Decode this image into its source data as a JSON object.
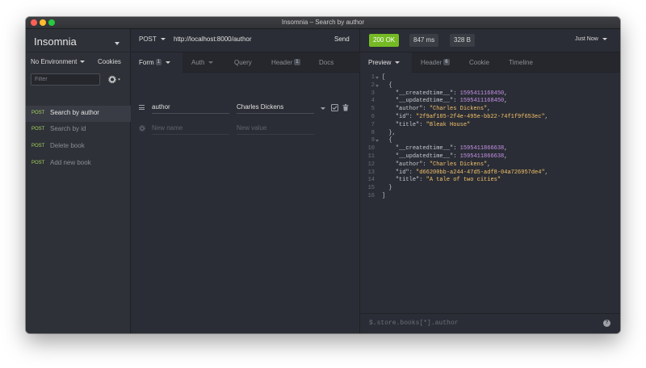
{
  "window": {
    "title": "Insomnia – Search by author"
  },
  "sidebar": {
    "brand": "Insomnia",
    "environment": "No Environment",
    "cookies": "Cookies",
    "filter_placeholder": "Filter",
    "requests": [
      {
        "method": "POST",
        "name": "Search by author",
        "active": true
      },
      {
        "method": "POST",
        "name": "Search by id",
        "active": false
      },
      {
        "method": "POST",
        "name": "Delete book",
        "active": false
      },
      {
        "method": "POST",
        "name": "Add new book",
        "active": false
      }
    ]
  },
  "request": {
    "method": "POST",
    "url": "http://localhost:8000/author",
    "send_label": "Send",
    "tabs": [
      {
        "label": "Form",
        "badge": "1",
        "active": true
      },
      {
        "label": "Auth",
        "badge": "",
        "active": false
      },
      {
        "label": "Query",
        "badge": "",
        "active": false
      },
      {
        "label": "Header",
        "badge": "1",
        "active": false
      },
      {
        "label": "Docs",
        "badge": "",
        "active": false
      }
    ],
    "form": {
      "rows": [
        {
          "name": "author",
          "value": "Charles Dickens"
        }
      ],
      "new_name_placeholder": "New name",
      "new_value_placeholder": "New value"
    }
  },
  "response": {
    "status": "200 OK",
    "time": "847 ms",
    "size": "328 B",
    "timestamp": "Just Now",
    "tabs": [
      {
        "label": "Preview",
        "badge": "",
        "active": true
      },
      {
        "label": "Header",
        "badge": "6",
        "active": false
      },
      {
        "label": "Cookie",
        "badge": "",
        "active": false
      },
      {
        "label": "Timeline",
        "badge": "",
        "active": false
      }
    ],
    "body_lines": [
      {
        "n": "1",
        "fold": true,
        "text": "["
      },
      {
        "n": "2",
        "fold": true,
        "text": "  {"
      },
      {
        "n": "3",
        "fold": false,
        "key": "\"__createdtime__\"",
        "value": "1595411168450",
        "vtype": "n",
        "comma": ","
      },
      {
        "n": "4",
        "fold": false,
        "key": "\"__updatedtime__\"",
        "value": "1595411168450",
        "vtype": "n",
        "comma": ","
      },
      {
        "n": "5",
        "fold": false,
        "key": "\"author\"",
        "value": "\"Charles Dickens\"",
        "vtype": "s",
        "comma": ","
      },
      {
        "n": "6",
        "fold": false,
        "key": "\"id\"",
        "value": "\"2f9af185-2f4e-495e-bb22-74f1f9f653ec\"",
        "vtype": "s",
        "comma": ","
      },
      {
        "n": "7",
        "fold": false,
        "key": "\"title\"",
        "value": "\"Bleak House\"",
        "vtype": "s",
        "comma": ""
      },
      {
        "n": "8",
        "fold": false,
        "text": "  },"
      },
      {
        "n": "9",
        "fold": true,
        "text": "  {"
      },
      {
        "n": "10",
        "fold": false,
        "key": "\"__createdtime__\"",
        "value": "1595411866638",
        "vtype": "n",
        "comma": ","
      },
      {
        "n": "11",
        "fold": false,
        "key": "\"__updatedtime__\"",
        "value": "1595411866638",
        "vtype": "n",
        "comma": ","
      },
      {
        "n": "12",
        "fold": false,
        "key": "\"author\"",
        "value": "\"Charles Dickens\"",
        "vtype": "s",
        "comma": ","
      },
      {
        "n": "13",
        "fold": false,
        "key": "\"id\"",
        "value": "\"d66200bb-a244-47d5-adf8-04a726957de4\"",
        "vtype": "s",
        "comma": ","
      },
      {
        "n": "14",
        "fold": false,
        "key": "\"title\"",
        "value": "\"A tale of two cities\"",
        "vtype": "s",
        "comma": ""
      },
      {
        "n": "15",
        "fold": false,
        "text": "  }"
      },
      {
        "n": "16",
        "fold": false,
        "text": "]"
      }
    ],
    "filter_placeholder": "$.store.books[*].author",
    "help": "?"
  },
  "colors": {
    "accent_green": "#75ba24",
    "method_green": "#a8d35e",
    "json_string": "#f5c26b",
    "json_number": "#c792ea"
  }
}
